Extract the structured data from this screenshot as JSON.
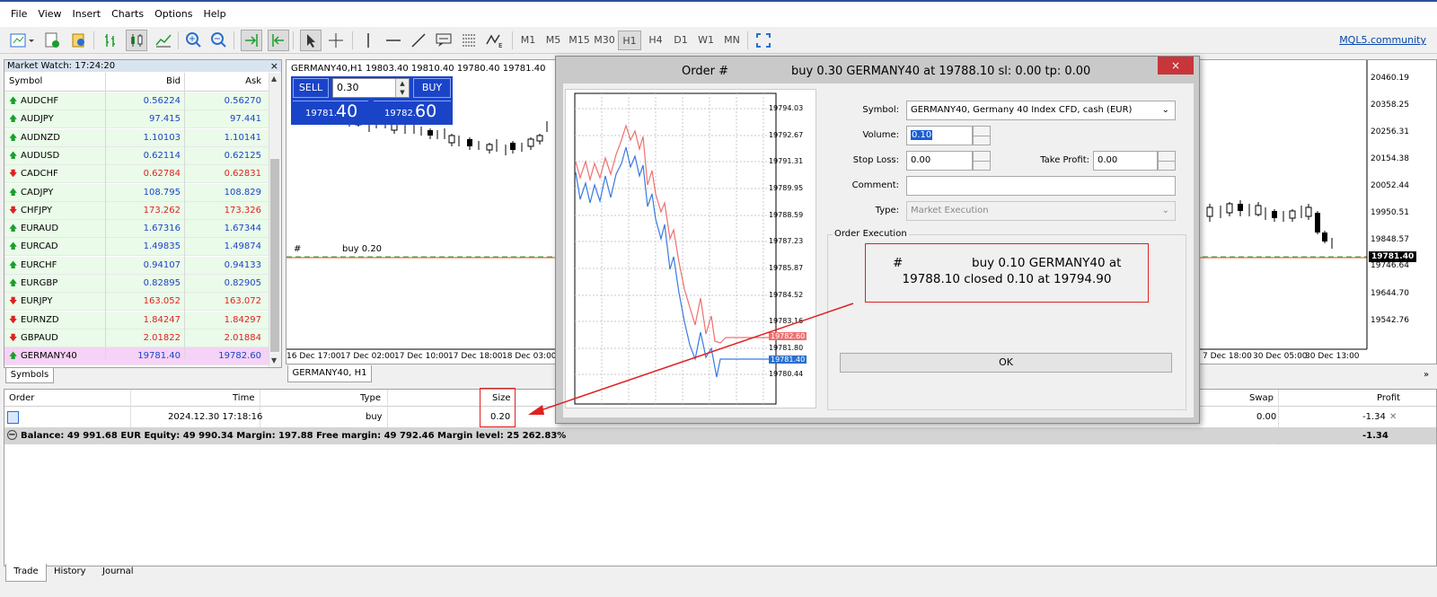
{
  "menu": [
    "File",
    "View",
    "Insert",
    "Charts",
    "Options",
    "Help"
  ],
  "toolbar": {
    "timeframes": [
      "M1",
      "M5",
      "M15",
      "M30",
      "H1",
      "H4",
      "D1",
      "W1",
      "MN"
    ],
    "active_timeframe": "H1",
    "community_link": "MQL5.community"
  },
  "market_watch": {
    "title": "Market Watch: 17:24:20",
    "headers": {
      "symbol": "Symbol",
      "bid": "Bid",
      "ask": "Ask"
    },
    "rows": [
      {
        "symbol": "AUDCHF",
        "bid": "0.56224",
        "ask": "0.56270",
        "dir": "up"
      },
      {
        "symbol": "AUDJPY",
        "bid": "97.415",
        "ask": "97.441",
        "dir": "up"
      },
      {
        "symbol": "AUDNZD",
        "bid": "1.10103",
        "ask": "1.10141",
        "dir": "up"
      },
      {
        "symbol": "AUDUSD",
        "bid": "0.62114",
        "ask": "0.62125",
        "dir": "up"
      },
      {
        "symbol": "CADCHF",
        "bid": "0.62784",
        "ask": "0.62831",
        "dir": "down"
      },
      {
        "symbol": "CADJPY",
        "bid": "108.795",
        "ask": "108.829",
        "dir": "up"
      },
      {
        "symbol": "CHFJPY",
        "bid": "173.262",
        "ask": "173.326",
        "dir": "down"
      },
      {
        "symbol": "EURAUD",
        "bid": "1.67316",
        "ask": "1.67344",
        "dir": "up"
      },
      {
        "symbol": "EURCAD",
        "bid": "1.49835",
        "ask": "1.49874",
        "dir": "up"
      },
      {
        "symbol": "EURCHF",
        "bid": "0.94107",
        "ask": "0.94133",
        "dir": "up"
      },
      {
        "symbol": "EURGBP",
        "bid": "0.82895",
        "ask": "0.82905",
        "dir": "up"
      },
      {
        "symbol": "EURJPY",
        "bid": "163.052",
        "ask": "163.072",
        "dir": "down"
      },
      {
        "symbol": "EURNZD",
        "bid": "1.84247",
        "ask": "1.84297",
        "dir": "down"
      },
      {
        "symbol": "GBPAUD",
        "bid": "2.01822",
        "ask": "2.01884",
        "dir": "down"
      },
      {
        "symbol": "GERMANY40",
        "bid": "19781.40",
        "ask": "19782.60",
        "dir": "up"
      }
    ],
    "tab": "Symbols"
  },
  "chart": {
    "title": "GERMANY40,H1  19803.40 19810.40 19780.40 19781.40",
    "tab": "GERMANY40, H1",
    "sell_label": "SELL",
    "buy_label": "BUY",
    "volume": "0.30",
    "sell_price_small": "19781.",
    "sell_price_big": "40",
    "buy_price_small": "19782.",
    "buy_price_big": "60",
    "order_line_hash": "#",
    "order_line_label": "buy 0.20",
    "price_axis": [
      "20460.19",
      "20358.25",
      "20256.31",
      "20154.38",
      "20052.44",
      "19950.51",
      "19848.57",
      "19746.64",
      "19644.70",
      "19542.76"
    ],
    "current_price": "19781.40",
    "time_axis_left": [
      "16 Dec 17:00",
      "17 Dec 02:00",
      "17 Dec 10:00",
      "17 Dec 18:00",
      "18 Dec 03:00"
    ],
    "time_axis_right": [
      "7 Dec 18:00",
      "30 Dec 05:00",
      "30 Dec 13:00"
    ]
  },
  "terminal": {
    "headers": {
      "order": "Order",
      "time": "Time",
      "type": "Type",
      "size": "Size",
      "swap": "Swap",
      "profit": "Profit"
    },
    "row": {
      "time": "2024.12.30 17:18:16",
      "type": "buy",
      "size": "0.20",
      "swap": "0.00",
      "profit": "-1.34"
    },
    "balance_line": "Balance: 49 991.68 EUR  Equity: 49 990.34  Margin: 197.88  Free margin: 49 792.46  Margin level: 25 262.83%",
    "balance_profit": "-1.34",
    "tabs": [
      "Trade",
      "History",
      "Journal"
    ]
  },
  "dialog": {
    "title_left": "Order #",
    "title_right": "buy 0.30 GERMANY40 at 19788.10 sl: 0.00 tp: 0.00",
    "close": "×",
    "symbol_label": "Symbol:",
    "symbol_value": "GERMANY40, Germany 40 Index CFD, cash (EUR)",
    "volume_label": "Volume:",
    "volume_value": "0.10",
    "stoploss_label": "Stop Loss:",
    "stoploss_value": "0.00",
    "takeprofit_label": "Take Profit:",
    "takeprofit_value": "0.00",
    "comment_label": "Comment:",
    "comment_value": "",
    "type_label": "Type:",
    "type_value": "Market Execution",
    "group_label": "Order Execution",
    "message_line1_hash": "#",
    "message_line1": "buy 0.10 GERMANY40 at",
    "message_line2": "19788.10 closed 0.10 at 19794.90",
    "ok_label": "OK",
    "mini_axis": [
      "19794.03",
      "19792.67",
      "19791.31",
      "19789.95",
      "19788.59",
      "19787.23",
      "19785.87",
      "19784.52",
      "19783.16",
      "19781.80",
      "19780.44"
    ],
    "ask_tag": "19782.60",
    "bid_tag": "19781.40"
  },
  "colors": {
    "annotation": "#e02020",
    "bid_blue": "#1a44c8",
    "down_red": "#e02020",
    "up_green": "#1a9e2c",
    "highlight": "#f6d2f6"
  }
}
